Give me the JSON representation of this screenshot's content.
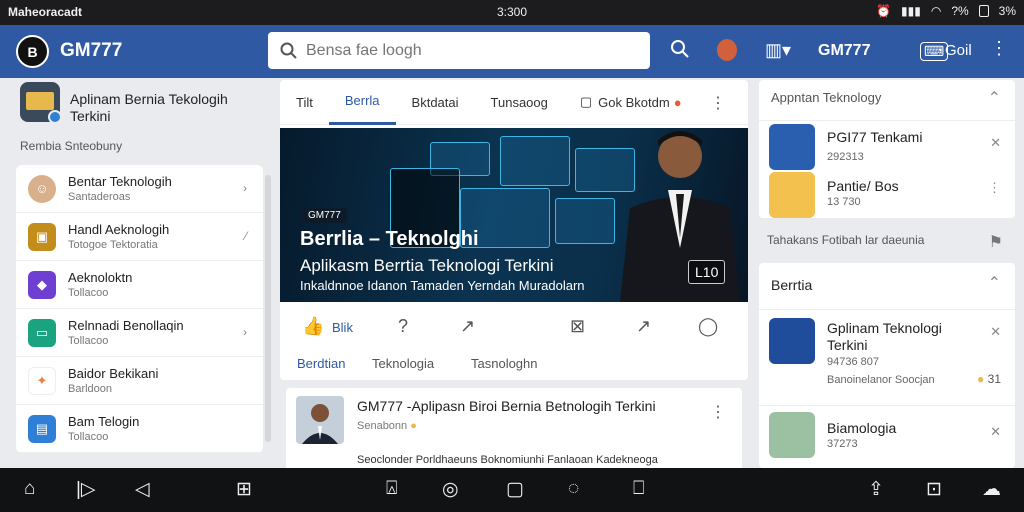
{
  "status": {
    "left": "Maheoracadt",
    "clock": "3:300",
    "battery": "3%",
    "wifi": "?%"
  },
  "appbar": {
    "logo": "B",
    "brand": "GM777",
    "search_placeholder": "Bensa fae loogh",
    "brand2": "GM777",
    "right_label": "Goil"
  },
  "left": {
    "profile_title": "Aplinam Bernia Tekologih Terkini",
    "section": "Rembia Snteobuny",
    "items": [
      {
        "title": "Bentar Teknologih",
        "sub": "Santaderoas",
        "color": "#d9b08c"
      },
      {
        "title": "Handl Aeknologih",
        "sub": "Totogoe Tektoratia",
        "color": "#c28d1a"
      },
      {
        "title": "Aeknoloktn",
        "sub": "Tollacoo",
        "color": "#6f3fd1"
      },
      {
        "title": "Relnnadi Benollaqin",
        "sub": "Tollacoo",
        "color": "#1aa37f"
      },
      {
        "title": "Baidor Bekikani",
        "sub": "Barldoon",
        "color": "#ef7d3e"
      },
      {
        "title": "Bam Telogin",
        "sub": "Tollacoo",
        "color": "#2f7fd6"
      }
    ]
  },
  "feed": {
    "tabs": [
      "Tilt",
      "Berrla",
      "Bktdatai",
      "Tunsaoog",
      "Gok Bkotdm"
    ],
    "hero_badge": "GM777",
    "hero_title": "Berrlia – Teknolghi",
    "hero_subtitle": "Aplikasm Berrtia Teknologi Terkini",
    "hero_desc": "Inkaldnnoe Idanon Tamaden Yerndah Muradolarn",
    "duration": "L10",
    "like_label": "Blik",
    "subtabs": [
      "Berdtian",
      "Teknologia",
      "Tasnologhn"
    ]
  },
  "post": {
    "title": "GM777 -Aplipasn Biroi Bernia Betnologih Terkini",
    "sub": "Senabonn",
    "desc": "Seoclonder Porldhaeuns Boknomiunhi Fanlaoan Kadekneoga"
  },
  "right": {
    "card1_head": "Appntan Teknology",
    "card1_items": [
      {
        "title": "PGI77 Tenkami",
        "sub": "292313"
      },
      {
        "title": "Pantie/ Bos",
        "sub": "13 730"
      }
    ],
    "trend_label": "Tahakans Fotibah lar daeunia",
    "card2_head": "Berrtia",
    "card2_items": [
      {
        "title": "Gplinam Teknologi Terkini",
        "sub": "94736 807",
        "sub2": "Banoinelanor Soocjan",
        "count": "31"
      },
      {
        "title": "Biamologia",
        "sub": "37273"
      }
    ]
  }
}
